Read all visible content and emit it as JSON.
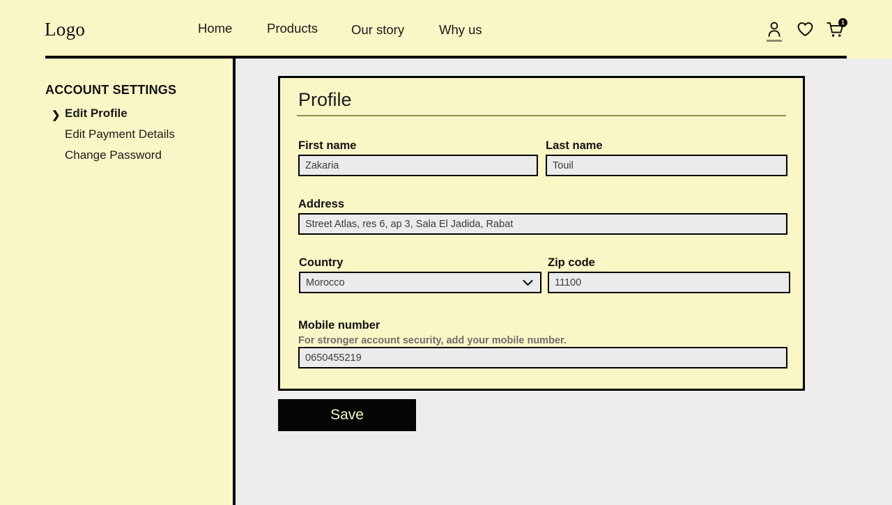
{
  "header": {
    "logo": "Logo",
    "nav": [
      {
        "label": "Home"
      },
      {
        "label": "Products"
      },
      {
        "label": "Our story"
      },
      {
        "label": "Why us"
      }
    ],
    "icons": {
      "account": "person-icon",
      "wishlist": "heart-icon",
      "cart": "shopping-cart-icon",
      "cart_badge": "1"
    }
  },
  "sidebar": {
    "title": "ACCOUNT SETTINGS",
    "items": [
      {
        "label": "Edit Profile",
        "active": true,
        "marker": "❯"
      },
      {
        "label": "Edit Payment Details",
        "active": false
      },
      {
        "label": "Change Password",
        "active": false
      }
    ]
  },
  "profile": {
    "title": "Profile",
    "fields": {
      "first_name": {
        "label": "First name",
        "value": "Zakaria"
      },
      "last_name": {
        "label": "Last name",
        "value": "Touil"
      },
      "address": {
        "label": "Address",
        "value": "Street Atlas, res 6, ap 3, Sala El Jadida, Rabat"
      },
      "country": {
        "label": "Country",
        "value": "Morocco",
        "options": [
          "Morocco"
        ]
      },
      "zip_code": {
        "label": "Zip code",
        "value": "11100"
      },
      "mobile_number": {
        "label": "Mobile number",
        "help": "For stronger account security, add your mobile number.",
        "value": "0650455219"
      }
    }
  },
  "actions": {
    "save_label": "Save"
  },
  "colors": {
    "cream": "#fbf6c6",
    "page_bg": "#ededed",
    "input_bg": "#ebebeb",
    "accent_rule": "#8b8b4e",
    "ink": "#000000"
  }
}
